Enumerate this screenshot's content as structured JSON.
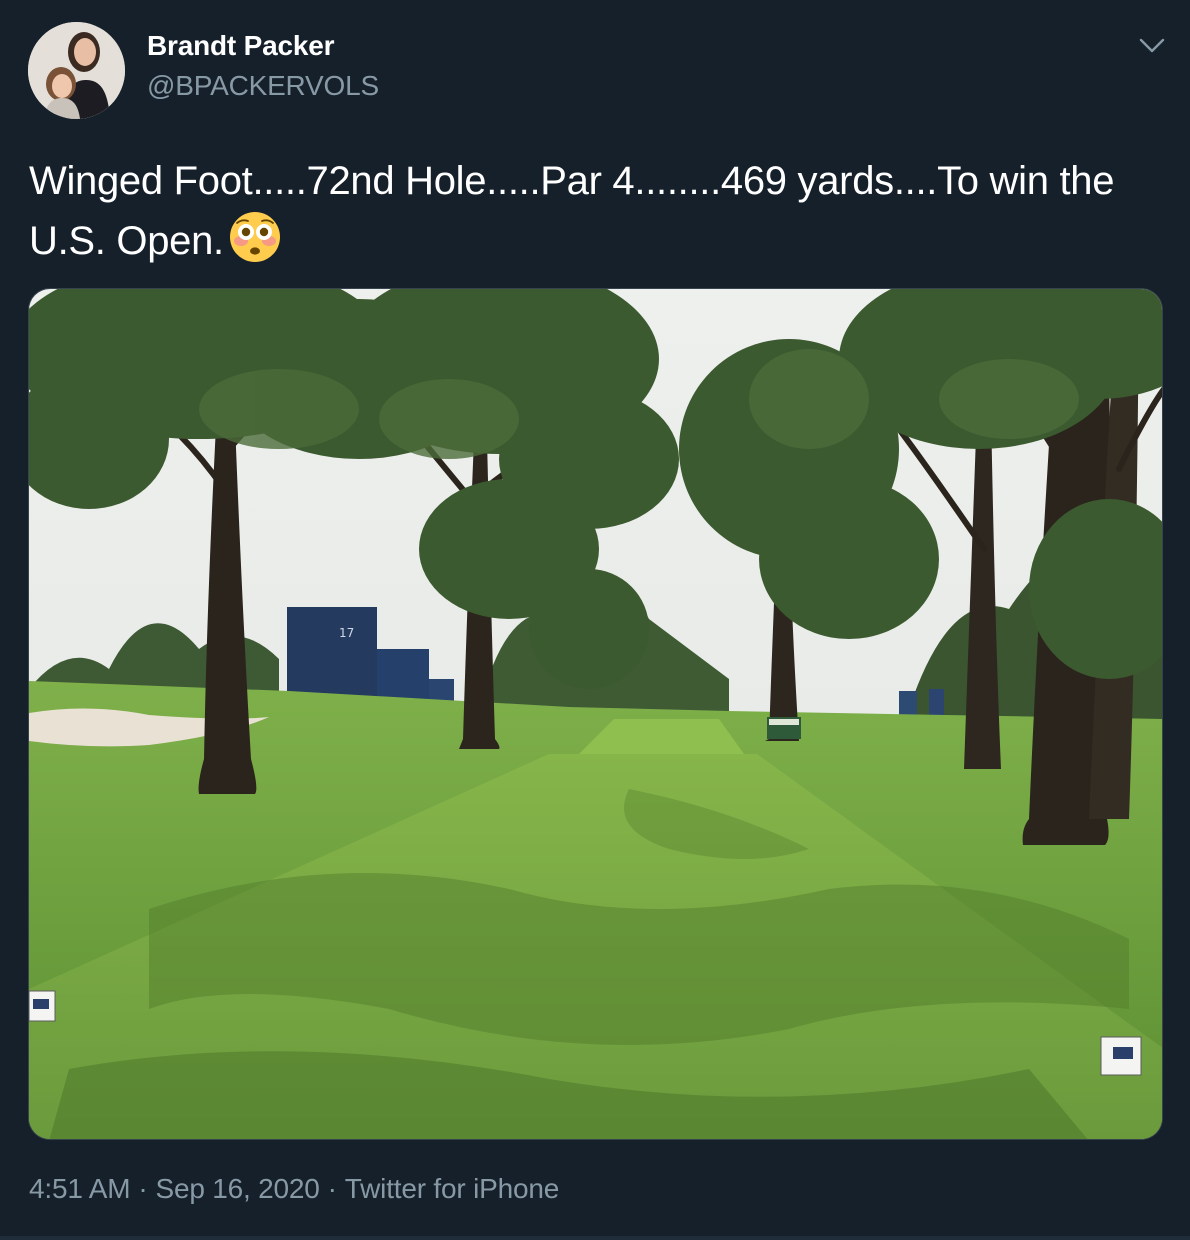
{
  "author": {
    "name": "Brandt Packer",
    "handle": "@BPACKERVOLS"
  },
  "tweet": {
    "text": "Winged Foot.....72nd Hole.....Par 4........469 yards....To win the U.S. Open.",
    "emoji": "flushed-face"
  },
  "media": {
    "tower_number": "17"
  },
  "meta": {
    "time": "4:51 AM",
    "date": "Sep 16, 2020",
    "source": "Twitter for iPhone",
    "separator": "·"
  },
  "icons": {
    "menu": "chevron-down-icon"
  },
  "colors": {
    "background": "#15202b",
    "primary_text": "#ffffff",
    "secondary_text": "#8899a6",
    "border": "#38444d"
  }
}
